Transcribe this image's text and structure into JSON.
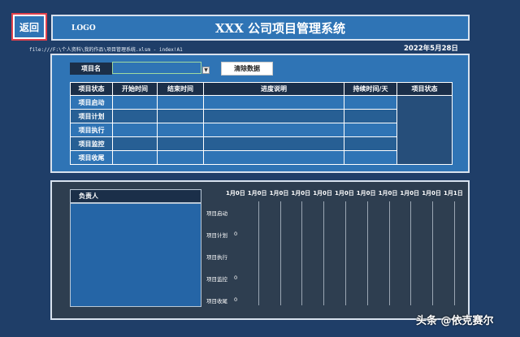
{
  "back_label": "返回",
  "logo": "LOGO",
  "title": "XXX 公司项目管理系统",
  "path_bar": "file:///F:\\个人资料\\我的作品\\项目管理系统.xlsm - index!A1",
  "date": "2022年5月28日",
  "project_label": "项目名",
  "project_value": "",
  "clear_label": "清除数据",
  "table": {
    "headers": [
      "项目状态",
      "开始时间",
      "结束时间",
      "进度说明",
      "持续时间/天",
      "项目状态"
    ],
    "rows": [
      {
        "phase": "项目启动",
        "start": "",
        "end": "",
        "desc": "",
        "duration": ""
      },
      {
        "phase": "项目计划",
        "start": "",
        "end": "",
        "desc": "",
        "duration": ""
      },
      {
        "phase": "项目执行",
        "start": "",
        "end": "",
        "desc": "",
        "duration": ""
      },
      {
        "phase": "项目监控",
        "start": "",
        "end": "",
        "desc": "",
        "duration": ""
      },
      {
        "phase": "项目收尾",
        "start": "",
        "end": "",
        "desc": "",
        "duration": ""
      }
    ]
  },
  "owner_label": "负责人",
  "chart_data": {
    "type": "bar",
    "categories": [
      "项目启动",
      "项目计划",
      "项目执行",
      "项目监控",
      "项目收尾"
    ],
    "values": [
      null,
      0,
      null,
      0,
      0
    ],
    "x_ticks": [
      "1月0日",
      "1月0日",
      "1月0日",
      "1月0日",
      "1月0日",
      "1月0日",
      "1月0日",
      "1月0日",
      "1月0日",
      "1月0日",
      "1月1日"
    ],
    "value_labels": [
      "",
      "0",
      "",
      "0",
      "0"
    ],
    "grid": true
  },
  "watermark": "头条 @依克赛尔",
  "colors": {
    "accent": "#2f74b5",
    "header_dark": "#1b2f49",
    "chart_bg": "#2e3e50",
    "back_border": "#e0404a"
  }
}
